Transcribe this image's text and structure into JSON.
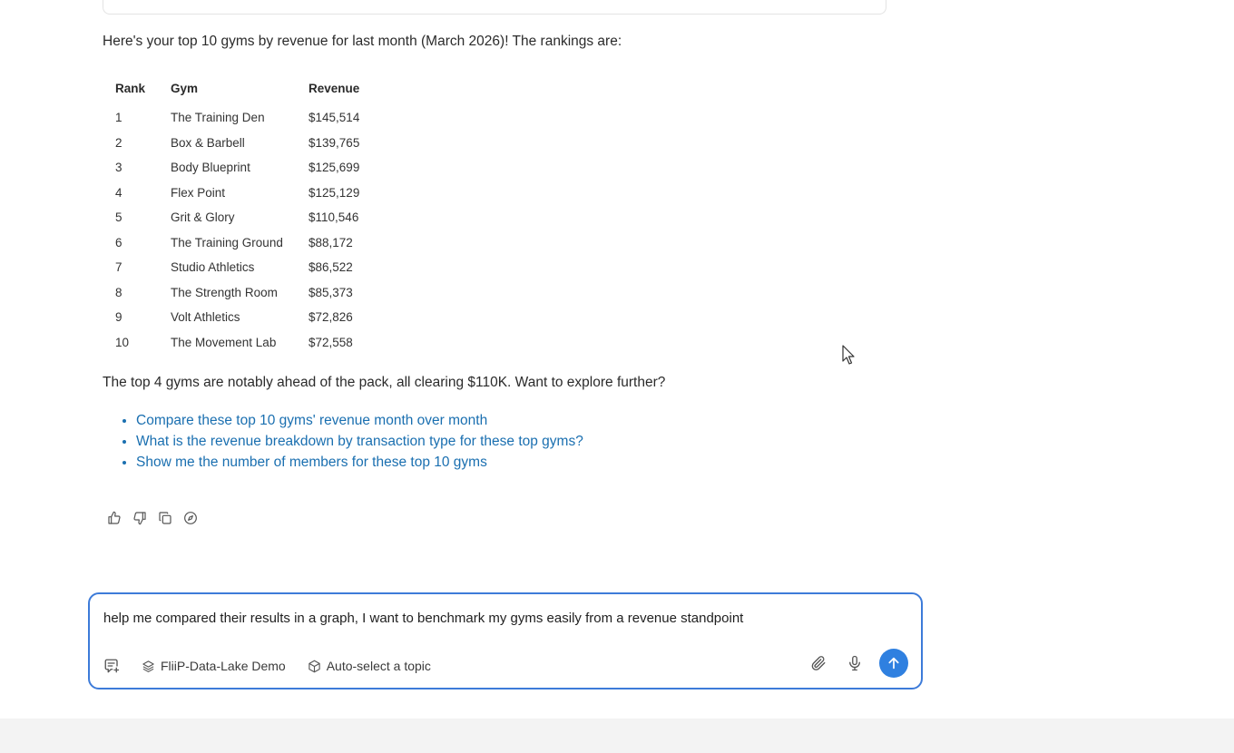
{
  "message": {
    "intro": "Here's your top 10 gyms by revenue for last month (March 2026)! The rankings are:",
    "table": {
      "headers": [
        "Rank",
        "Gym",
        "Revenue"
      ],
      "rows": [
        [
          "1",
          "The Training Den",
          "$145,514"
        ],
        [
          "2",
          "Box & Barbell",
          "$139,765"
        ],
        [
          "3",
          "Body Blueprint",
          "$125,699"
        ],
        [
          "4",
          "Flex Point",
          "$125,129"
        ],
        [
          "5",
          "Grit & Glory",
          "$110,546"
        ],
        [
          "6",
          "The Training Ground",
          "$88,172"
        ],
        [
          "7",
          "Studio Athletics",
          "$86,522"
        ],
        [
          "8",
          "The Strength Room",
          "$85,373"
        ],
        [
          "9",
          "Volt Athletics",
          "$72,826"
        ],
        [
          "10",
          "The Movement Lab",
          "$72,558"
        ]
      ]
    },
    "summary": "The top 4 gyms are notably ahead of the pack, all clearing $110K. Want to explore further?",
    "suggestions": [
      "Compare these top 10 gyms' revenue month over month",
      "What is the revenue breakdown by transaction type for these top gyms?",
      "Show me the number of members for these top 10 gyms"
    ],
    "actions": [
      {
        "name": "thumbs-up-icon"
      },
      {
        "name": "thumbs-down-icon"
      },
      {
        "name": "copy-icon"
      },
      {
        "name": "compass-icon"
      }
    ]
  },
  "composer": {
    "input_value": "help me compared their results in a graph, I want to benchmark my gyms easily from a revenue standpoint",
    "data_source": "FliiP-Data-Lake Demo",
    "topic": "Auto-select a topic",
    "icons": {
      "new_chat": "new-chat-icon",
      "data_source": "layers-icon",
      "topic": "cube-icon",
      "attach": "paperclip-icon",
      "mic": "microphone-icon",
      "send": "arrow-up-icon"
    }
  },
  "colors": {
    "accent": "#2f80e0",
    "link": "#1a6fb0",
    "composer_border": "#3d7bd9",
    "footer": "#f3f3f3"
  }
}
